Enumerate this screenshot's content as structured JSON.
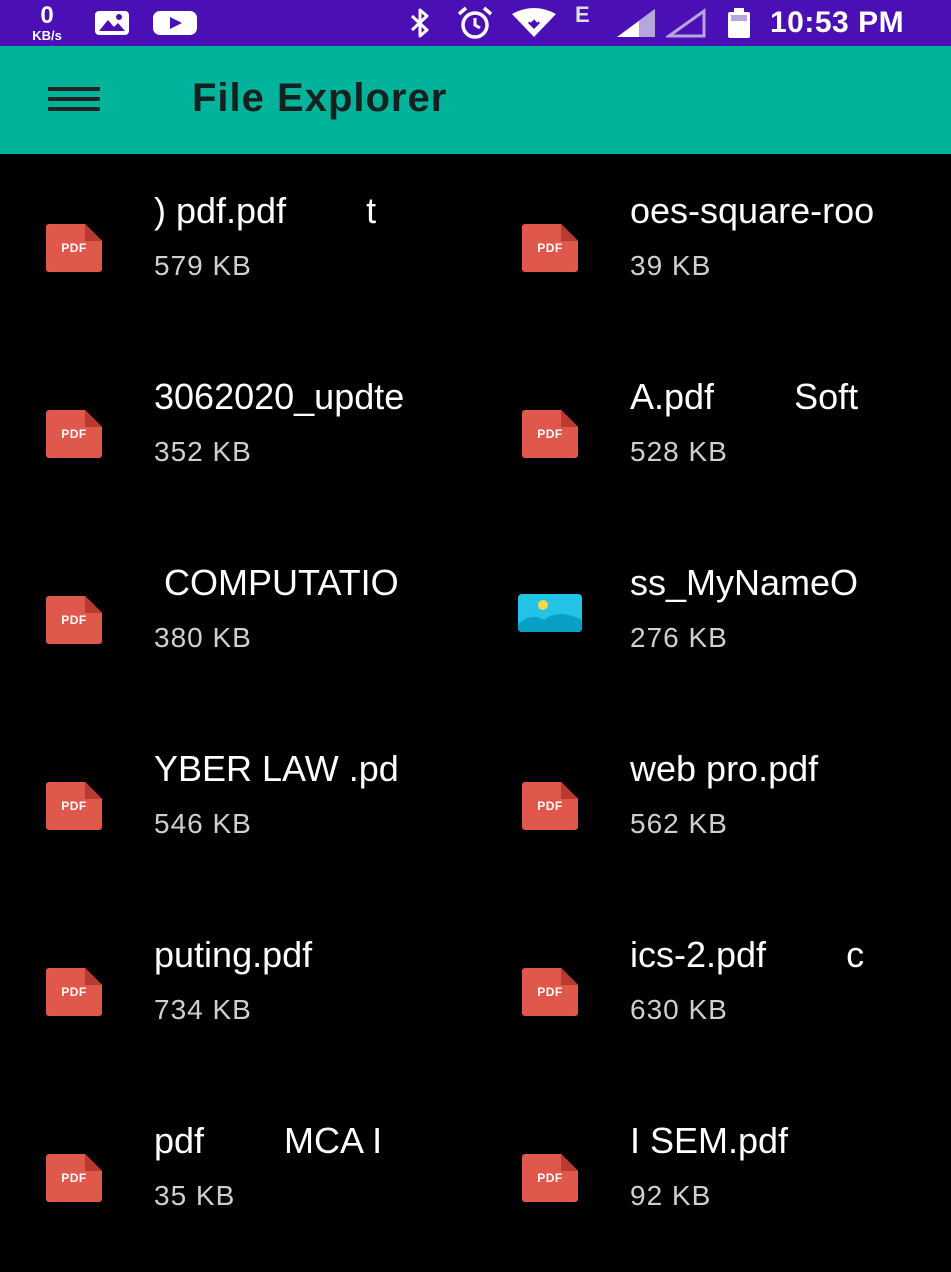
{
  "status_bar": {
    "net_speed_value": "0",
    "net_speed_unit": "KB/s",
    "network_type": "E",
    "time": "10:53 PM",
    "icons": [
      "gallery-icon",
      "youtube-icon",
      "bluetooth-icon",
      "alarm-icon",
      "wifi-icon",
      "signal-icon",
      "signal-empty-icon",
      "battery-icon"
    ]
  },
  "app_bar": {
    "title": "File Explorer",
    "background": "#00b39a"
  },
  "pdf_label": "PDF",
  "files": [
    {
      "name": ") pdf.pdf        t",
      "size": "579 KB",
      "type": "pdf"
    },
    {
      "name": "oes-square-roo",
      "size": "39 KB",
      "type": "pdf"
    },
    {
      "name": "3062020_updte",
      "size": "352 KB",
      "type": "pdf"
    },
    {
      "name": "A.pdf        Soft",
      "size": "528 KB",
      "type": "pdf"
    },
    {
      "name": " COMPUTATIO",
      "size": "380 KB",
      "type": "pdf"
    },
    {
      "name": "ss_MyNameO",
      "size": "276 KB",
      "type": "image"
    },
    {
      "name": "YBER LAW .pd",
      "size": "546 KB",
      "type": "pdf"
    },
    {
      "name": "web pro.pdf",
      "size": "562 KB",
      "type": "pdf"
    },
    {
      "name": "puting.pdf",
      "size": "734 KB",
      "type": "pdf"
    },
    {
      "name": "ics-2.pdf        c",
      "size": "630 KB",
      "type": "pdf"
    },
    {
      "name": "pdf        MCA I",
      "size": "35 KB",
      "type": "pdf"
    },
    {
      "name": "I SEM.pdf",
      "size": "92 KB",
      "type": "pdf"
    }
  ]
}
